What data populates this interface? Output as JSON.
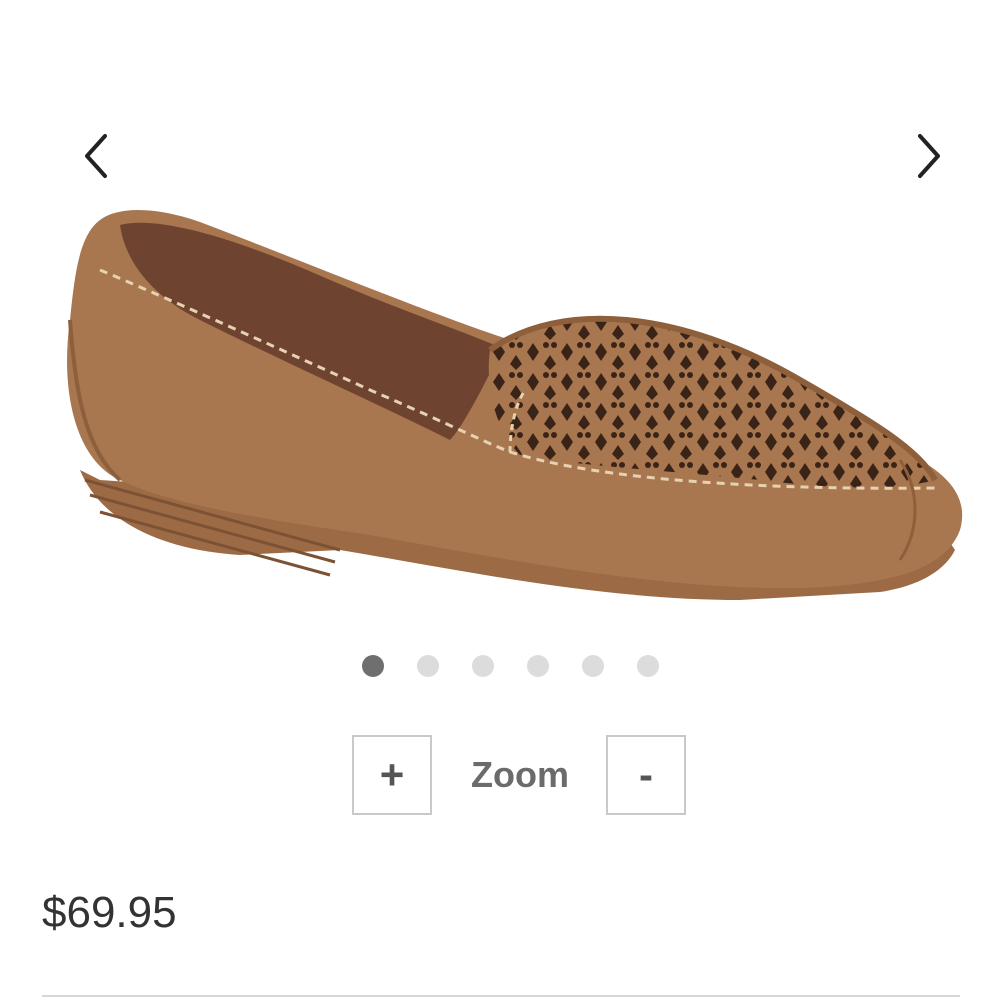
{
  "carousel": {
    "prev_icon": "chevron-left-icon",
    "next_icon": "chevron-right-icon",
    "dot_count": 6,
    "active_index": 0,
    "product_colors": {
      "suede": "#a8764f",
      "suede_dark": "#8e5f3b",
      "lining": "#6e4330",
      "sole": "#9c6b45",
      "stitch": "#e6d2b0"
    }
  },
  "zoom": {
    "in_label": "+",
    "label": "Zoom",
    "out_label": "-"
  },
  "product": {
    "price": "$69.95"
  }
}
